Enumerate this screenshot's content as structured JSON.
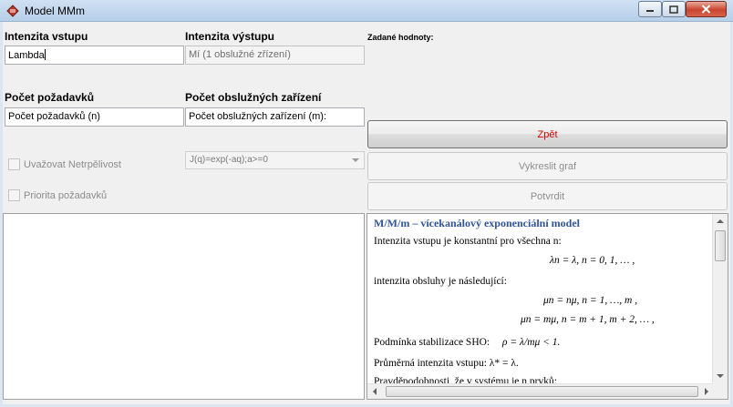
{
  "window": {
    "title": "Model MMm",
    "icon": "app-diamond-icon",
    "accent_color": "#c9452f"
  },
  "form": {
    "intenzita_vstupu": {
      "label": "Intenzita vstupu",
      "value": "Lambda"
    },
    "intenzita_vystupu": {
      "label": "Intenzita výstupu",
      "placeholder": "Mí (1 obslužné zřízení)"
    },
    "zadane_hodnoty": {
      "label": "Zadané hodnoty:"
    },
    "pocet_pozadavku": {
      "label": "Počet požadavků",
      "value": "Počet požadavků (n)"
    },
    "pocet_zarizeni": {
      "label": "Počet obslužných zařízení",
      "value": "Počet obslužných zařízení (m):"
    }
  },
  "buttons": {
    "zpet": "Zpět",
    "vykreslit": "Vykreslit graf",
    "potvrdit": "Potvrdit",
    "zpet_color": "#d80000"
  },
  "options": {
    "netrpelivost": "Uvažovat Netrpělivost",
    "priorita": "Priorita požadavků",
    "impatience_function": "J(q)=exp(-aq);a>=0"
  },
  "doc": {
    "heading": "M/M/m – vícekanálový  exponenciální  model",
    "p1": "Intenzita vstupu je konstantní pro všechna n:",
    "eq1": "λn = λ,      n = 0, 1, … ,",
    "p2": "intenzita  obsluhy je následující:",
    "eq2": "μn = nμ,      n = 1, …, m ,",
    "eq3": "μn = mμ,      n = m + 1, m + 2, … ,",
    "p3": "Podmínka stabilizace SHO:",
    "eq4": "ρ = λ/mμ < 1.",
    "p4": "Průměrná intenzita vstupu:  λ* = λ.",
    "p5": "Pravděpodobnosti, že v systému je n prvků:"
  }
}
